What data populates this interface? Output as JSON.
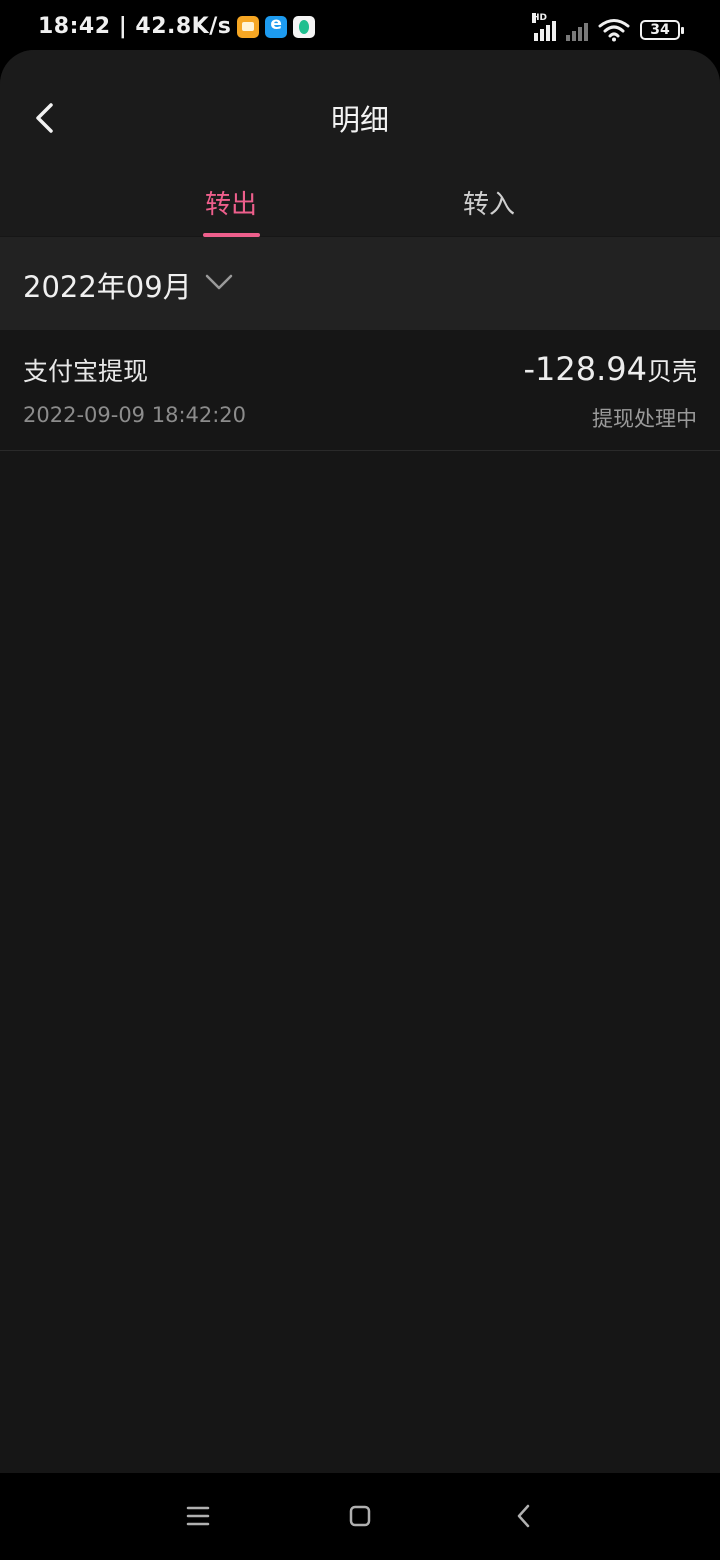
{
  "status_bar": {
    "time": "18:42 | 42.8K/s",
    "battery": "34",
    "network_label": "HD"
  },
  "header": {
    "title": "明细"
  },
  "tabs": [
    {
      "label": "转出",
      "active": true
    },
    {
      "label": "转入",
      "active": false
    }
  ],
  "month_filter": {
    "label": "2022年09月"
  },
  "records": [
    {
      "title": "支付宝提现",
      "time": "2022-09-09 18:42:20",
      "amount": "-128.94",
      "unit": "贝壳",
      "status": "提现处理中"
    }
  ],
  "colors": {
    "accent": "#ee5f8c",
    "background": "#161616",
    "header": "#1b1b1b",
    "month_bar": "#222222"
  },
  "icons": {
    "back": "chevron-left-icon",
    "dropdown": "chevron-down-icon",
    "nav_menu": "menu-icon",
    "nav_home": "square-icon",
    "nav_back": "back-triangle-icon"
  }
}
